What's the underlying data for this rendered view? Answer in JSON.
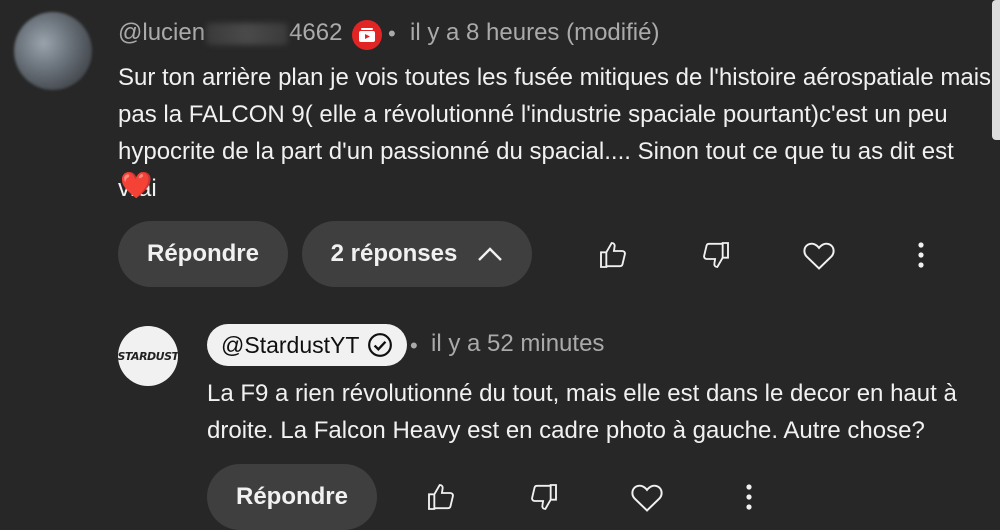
{
  "comment": {
    "author_prefix": "@lucien",
    "author_suffix": "4662",
    "separator": "•",
    "timestamp": "il y a 8 heures (modifié)",
    "text": "Sur ton arrière plan je vois toutes les fusée mitiques de l'histoire aérospatiale mais pas la FALCON 9( elle a révolutionné l'industrie spaciale pourtant)c'est un peu hypocrite de la part d'un passionné du spacial.... Sinon tout ce que tu as dit est vrai",
    "emoji": "❤️",
    "actions": {
      "reply_label": "Répondre",
      "replies_label": "2 réponses"
    }
  },
  "reply": {
    "author": "@StardustYT",
    "avatar_text": "STARDUST",
    "separator": "•",
    "timestamp": "il y a 52 minutes",
    "text": "La F9 a rien révolutionné du tout, mais elle est dans le decor en haut à droite. La Falcon Heavy est en cadre photo à gauche. Autre chose?",
    "actions": {
      "reply_label": "Répondre"
    }
  },
  "colors": {
    "background": "#272727",
    "pill": "#3f3f3f",
    "badge_red": "#e32424",
    "text": "#f1f1f1",
    "meta": "#aaaaaa"
  }
}
